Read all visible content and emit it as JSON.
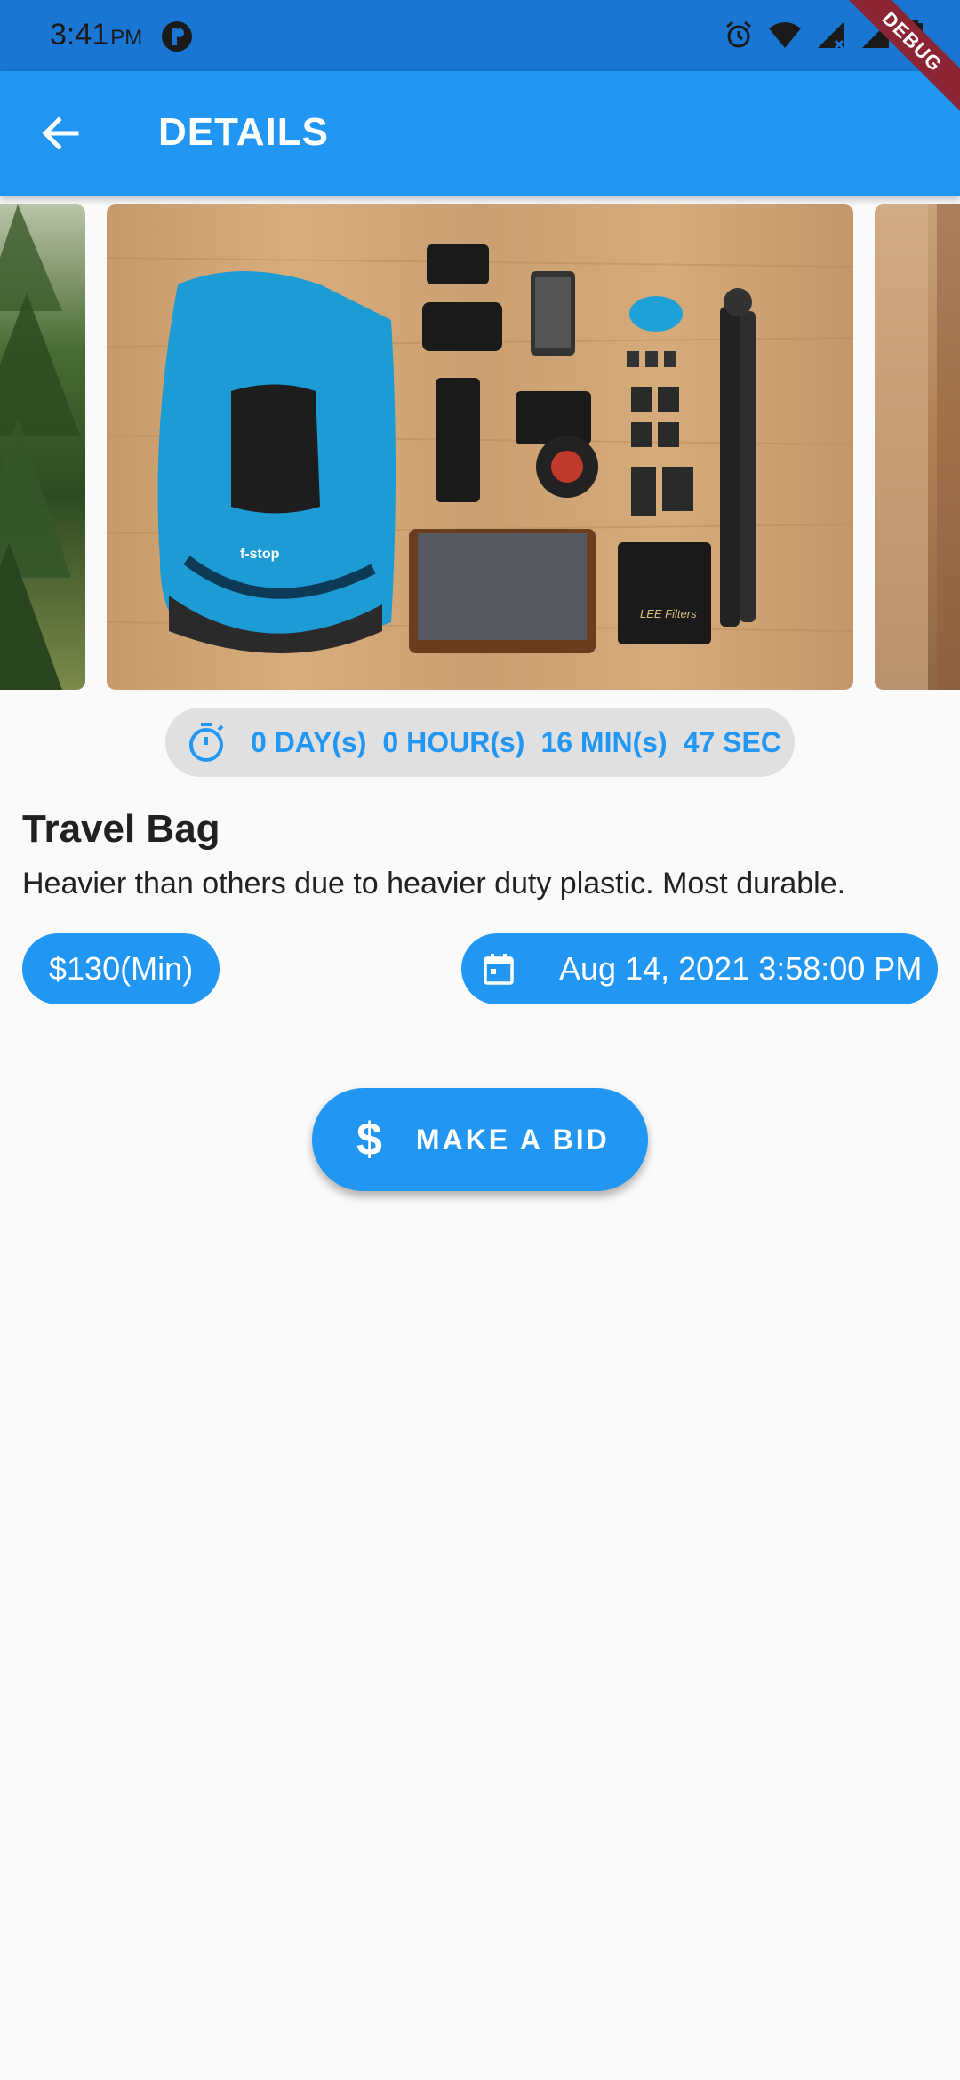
{
  "status_bar": {
    "time": "3:41",
    "ampm": "PM",
    "icons": [
      "app-icon",
      "alarm-icon",
      "wifi-icon",
      "signal-icon",
      "signal-x-icon",
      "battery-icon"
    ]
  },
  "debug_banner": "DEBUG",
  "app_bar": {
    "title": "DETAILS",
    "back_icon": "arrow-back-icon"
  },
  "carousel": {
    "images": [
      "pine-trees",
      "travel-bag-gear",
      "blurred-wood"
    ],
    "active_index": 1
  },
  "timer": {
    "days": "0 DAY(s)",
    "hours": "0 HOUR(s)",
    "minutes": "16 MIN(s)",
    "seconds": "47 SEC",
    "icon": "stopwatch-icon"
  },
  "item": {
    "title": "Travel Bag",
    "description": "Heavier than others due to heavier duty plastic. Most durable.",
    "price": "$130(Min)",
    "end_date": "Aug 14, 2021 3:58:00 PM",
    "date_icon": "calendar-icon"
  },
  "bid_button": {
    "icon": "$",
    "label": "MAKE A BID"
  },
  "colors": {
    "primary": "#2196f3",
    "status_bar": "#1976d2",
    "debug": "#8b2433"
  }
}
